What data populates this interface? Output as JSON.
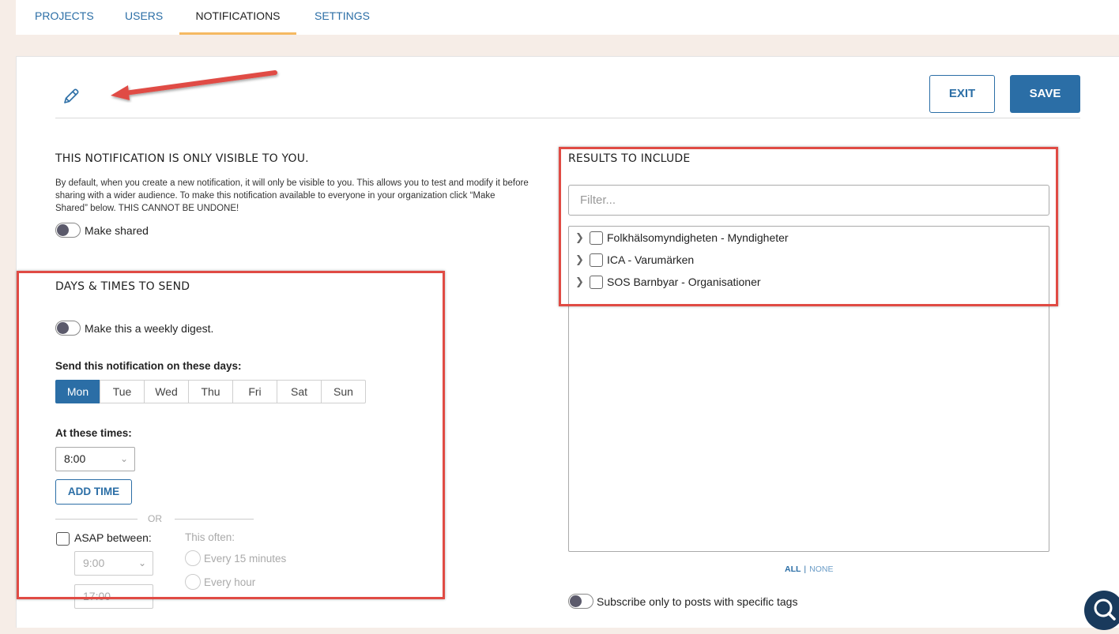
{
  "nav": {
    "tabs": [
      {
        "label": "PROJECTS"
      },
      {
        "label": "USERS"
      },
      {
        "label": "NOTIFICATIONS",
        "active": true
      },
      {
        "label": "SETTINGS"
      }
    ]
  },
  "header": {
    "exit_label": "EXIT",
    "save_label": "SAVE"
  },
  "visibility": {
    "title": "THIS NOTIFICATION IS ONLY VISIBLE TO YOU.",
    "description": "By default, when you create a new notification, it will only be visible to you. This allows you to test and modify it before sharing with a wider audience. To make this notification available to everyone in your organization click “Make Shared” below. THIS CANNOT BE UNDONE!",
    "toggle_label": "Make shared",
    "toggle_on": false
  },
  "schedule": {
    "title": "DAYS & TIMES TO SEND",
    "digest_label": "Make this a weekly digest.",
    "digest_on": false,
    "days_label": "Send this notification on these days:",
    "days": [
      "Mon",
      "Tue",
      "Wed",
      "Thu",
      "Fri",
      "Sat",
      "Sun"
    ],
    "selected_day": "Mon",
    "times_label": "At these times:",
    "time_value": "8:00",
    "add_time_label": "ADD TIME",
    "or_label": "OR",
    "asap_label": "ASAP between:",
    "asap_start": "9:00",
    "asap_end": "17:00",
    "often_label": "This often:",
    "often_options": [
      "Every 15 minutes",
      "Every hour"
    ]
  },
  "results": {
    "title": "RESULTS TO INCLUDE",
    "filter_placeholder": "Filter...",
    "items": [
      {
        "label": "Folkhälsomyndigheten - Myndigheter"
      },
      {
        "label": "ICA - Varumärken"
      },
      {
        "label": "SOS Barnbyar - Organisationer"
      }
    ],
    "all_label": "ALL",
    "separator": "|",
    "none_label": "NONE",
    "tags_toggle_label": "Subscribe only to posts with specific tags",
    "tags_toggle_on": false
  },
  "colors": {
    "accent": "#2b6ea6",
    "tab_underline": "#f5b962",
    "annotation_red": "#e04b44",
    "page_bg": "#f6ede7"
  },
  "icons": {
    "edit": "pencil-icon",
    "annotation": "arrow-annotation-icon",
    "help": "search-chat-icon"
  }
}
